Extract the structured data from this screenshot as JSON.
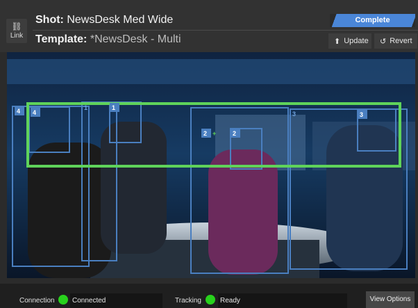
{
  "header": {
    "link_icon": "link-icon",
    "link_label": "Link",
    "shot_prefix": "Shot:",
    "shot_name": "NewsDesk Med Wide",
    "template_prefix": "Template:",
    "template_name": "*NewsDesk - Multi",
    "status_label": "Complete",
    "status_color": "#4a86d8",
    "update_icon": "update-icon",
    "update_label": "Update",
    "revert_icon": "revert-icon",
    "revert_label": "Revert"
  },
  "viewport": {
    "framing_color": "#5fd35a",
    "region_color": "#4a7fc0",
    "region_labels": [
      "4",
      "4",
      "1",
      "1",
      "2",
      "2",
      "3",
      "3"
    ],
    "plus_marker": "+"
  },
  "statusbar": {
    "connection_label": "Connection",
    "connection_value": "Connected",
    "tracking_label": "Tracking",
    "tracking_value": "Ready",
    "status_ok_color": "#28d11c",
    "view_options_label": "View Options"
  }
}
